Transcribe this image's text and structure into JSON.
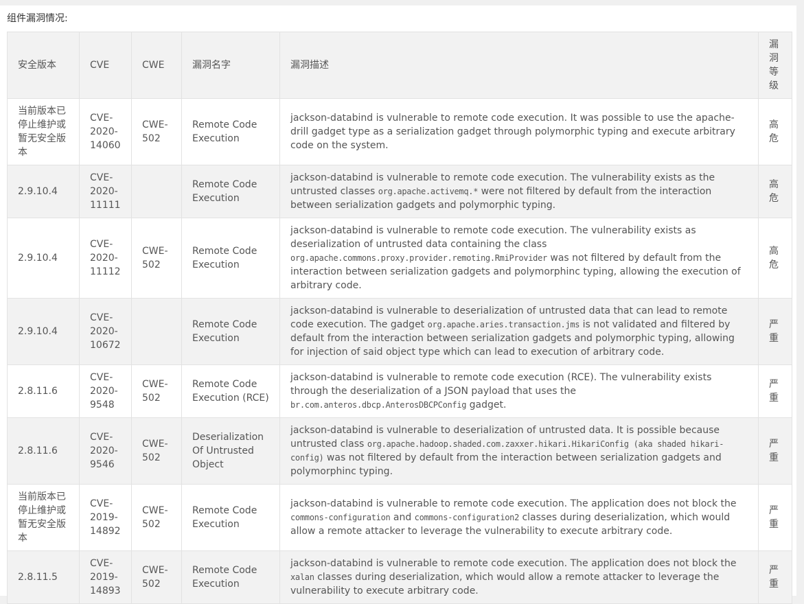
{
  "section_title": "组件漏洞情况:",
  "columns": {
    "version": "安全版本",
    "cve": "CVE",
    "cwe": "CWE",
    "name": "漏洞名字",
    "desc": "漏洞描述",
    "level": "漏洞等级"
  },
  "rows": [
    {
      "version": "当前版本已停止维护或暂无安全版本",
      "cve": "CVE-2020-14060",
      "cwe": "CWE-502",
      "name": "Remote Code Execution",
      "desc": [
        {
          "t": "jackson-databind is vulnerable to remote code execution. It was possible to use the apache-drill gadget type as a serialization gadget through polymorphic typing and execute arbitrary code on the system."
        }
      ],
      "level": "高危"
    },
    {
      "version": "2.9.10.4",
      "cve": "CVE-2020-11111",
      "cwe": "",
      "name": "Remote Code Execution",
      "desc": [
        {
          "t": "jackson-databind is vulnerable to remote code execution. The vulnerability exists as the untrusted classes "
        },
        {
          "t": "org.apache.activemq.*",
          "code": true
        },
        {
          "t": " were not filtered by default from the interaction between serialization gadgets and polymorphic typing."
        }
      ],
      "level": "高危"
    },
    {
      "version": "2.9.10.4",
      "cve": "CVE-2020-11112",
      "cwe": "CWE-502",
      "name": "Remote Code Execution",
      "desc": [
        {
          "t": "jackson-databind is vulnerable to remote code execution. The vulnerability exists as deserialization of untrusted data containing the class "
        },
        {
          "t": "org.apache.commons.proxy.provider.remoting.RmiProvider",
          "code": true
        },
        {
          "t": " was not filtered by default from the interaction between serialization gadgets and polymorphinc typing, allowing the execution of arbitrary code."
        }
      ],
      "level": "高危"
    },
    {
      "version": "2.9.10.4",
      "cve": "CVE-2020-10672",
      "cwe": "",
      "name": "Remote Code Execution",
      "desc": [
        {
          "t": "jackson-databind is vulnerable to deserialization of untrusted data that can lead to remote code execution. The gadget "
        },
        {
          "t": "org.apache.aries.transaction.jms",
          "code": true
        },
        {
          "t": " is not validated and filtered by default from the interaction between serialization gadgets and polymorphic typing, allowing for injection of said object type which can lead to execution of arbitrary code."
        }
      ],
      "level": "严重"
    },
    {
      "version": "2.8.11.6",
      "cve": "CVE-2020-9548",
      "cwe": "CWE-502",
      "name": "Remote Code Execution (RCE)",
      "desc": [
        {
          "t": "jackson-databind is vulnerable to remote code execution (RCE). The vulnerability exists through the deserialization of a JSON payload that uses the "
        },
        {
          "t": "br.com.anteros.dbcp.AnterosDBCPConfig",
          "code": true
        },
        {
          "t": " gadget."
        }
      ],
      "level": "严重"
    },
    {
      "version": "2.8.11.6",
      "cve": "CVE-2020-9546",
      "cwe": "CWE-502",
      "name": "Deserialization Of Untrusted Object",
      "desc": [
        {
          "t": "jackson-databind is vulnerable to deserialization of untrusted data. It is possible because untrusted class "
        },
        {
          "t": "org.apache.hadoop.shaded.com.zaxxer.hikari.HikariConfig (aka shaded hikari-config)",
          "code": true
        },
        {
          "t": " was not filtered by default from the interaction between serialization gadgets and polymorphinc typing."
        }
      ],
      "level": "严重"
    },
    {
      "version": "当前版本已停止维护或暂无安全版本",
      "cve": "CVE-2019-14892",
      "cwe": "CWE-502",
      "name": "Remote Code Execution",
      "desc": [
        {
          "t": "jackson-databind is vulnerable to remote code execution. The application does not block the "
        },
        {
          "t": "commons-configuration",
          "code": true
        },
        {
          "t": " and "
        },
        {
          "t": "commons-configuration2",
          "code": true
        },
        {
          "t": " classes during deserialization, which would allow a remote attacker to leverage the vulnerability to execute arbitrary code."
        }
      ],
      "level": "严重"
    },
    {
      "version": "2.8.11.5",
      "cve": "CVE-2019-14893",
      "cwe": "CWE-502",
      "name": "Remote Code Execution",
      "desc": [
        {
          "t": "jackson-databind is vulnerable to remote code execution. The application does not block the "
        },
        {
          "t": "xalan",
          "code": true
        },
        {
          "t": " classes during deserialization, which would allow a remote attacker to leverage the vulnerability to execute arbitrary code."
        }
      ],
      "level": "严重"
    }
  ]
}
